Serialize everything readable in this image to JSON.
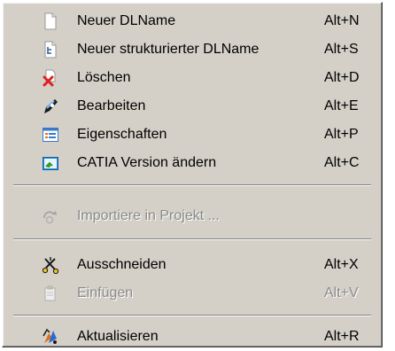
{
  "menu": {
    "items": [
      {
        "label": "Neuer DLName",
        "shortcut": "Alt+N",
        "icon": "new-document-icon",
        "enabled": true
      },
      {
        "label": "Neuer strukturierter DLName",
        "shortcut": "Alt+S",
        "icon": "structured-document-icon",
        "enabled": true
      },
      {
        "label": "Löschen",
        "shortcut": "Alt+D",
        "icon": "delete-icon",
        "enabled": true
      },
      {
        "label": "Bearbeiten",
        "shortcut": "Alt+E",
        "icon": "edit-icon",
        "enabled": true
      },
      {
        "label": "Eigenschaften",
        "shortcut": "Alt+P",
        "icon": "properties-icon",
        "enabled": true
      },
      {
        "label": "CATIA Version ändern",
        "shortcut": "Alt+C",
        "icon": "catia-version-icon",
        "enabled": true
      },
      {
        "label": "Importiere in Projekt ...",
        "shortcut": "",
        "icon": "import-icon",
        "enabled": false
      },
      {
        "label": "Ausschneiden",
        "shortcut": "Alt+X",
        "icon": "cut-icon",
        "enabled": true
      },
      {
        "label": "Einfügen",
        "shortcut": "Alt+V",
        "icon": "paste-icon",
        "enabled": false
      },
      {
        "label": "Aktualisieren",
        "shortcut": "Alt+R",
        "icon": "refresh-icon",
        "enabled": true
      }
    ]
  },
  "colors": {
    "menu_background": "#d4d0c8",
    "disabled_text": "#8a8a8a",
    "delete_red": "#e02020",
    "catia_blue": "#2a8fd8"
  }
}
